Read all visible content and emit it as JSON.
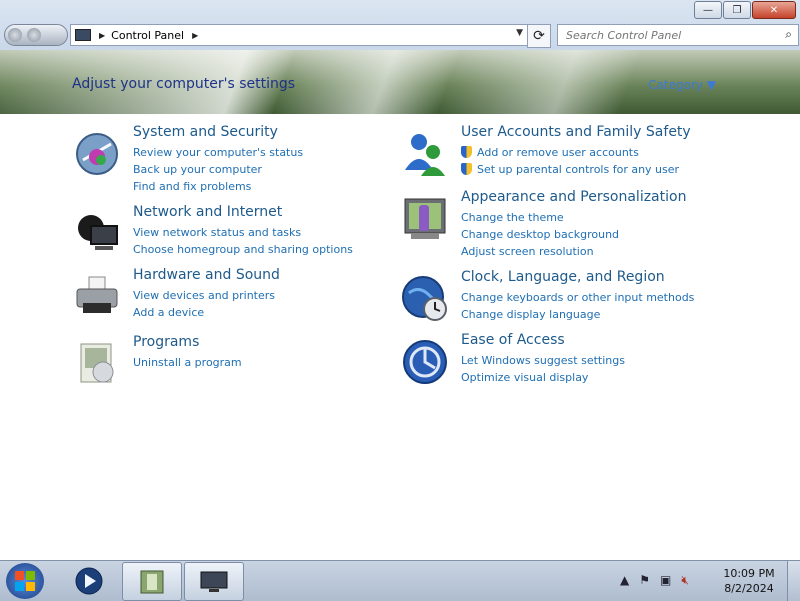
{
  "window": {
    "controls": {
      "minimize": "—",
      "maximize": "❐",
      "close": "✕"
    }
  },
  "address_bar": {
    "crumbs": [
      "Control Panel"
    ],
    "refresh_glyph": "⟳"
  },
  "search": {
    "placeholder": "Search Control Panel"
  },
  "banner": {
    "title": "Adjust your computer's settings",
    "view_by_label": "View by:",
    "view_by_value": "Category ▼"
  },
  "categories": {
    "left": [
      {
        "title": "System and Security",
        "icon": "system-security-icon",
        "links": [
          "Review your computer's status",
          "Back up your computer",
          "Find and fix problems"
        ]
      },
      {
        "title": "Network and Internet",
        "icon": "network-icon",
        "links": [
          "View network status and tasks",
          "Choose homegroup and sharing options"
        ]
      },
      {
        "title": "Hardware and Sound",
        "icon": "printer-icon",
        "links": [
          "View devices and printers",
          "Add a device"
        ]
      },
      {
        "title": "Programs",
        "icon": "programs-icon",
        "links": [
          "Uninstall a program"
        ]
      }
    ],
    "right": [
      {
        "title": "User Accounts and Family Safety",
        "icon": "users-icon",
        "links": [
          "Add or remove user accounts",
          "Set up parental controls for any user"
        ]
      },
      {
        "title": "Appearance and Personalization",
        "icon": "appearance-icon",
        "links": [
          "Change the theme",
          "Change desktop background",
          "Adjust screen resolution"
        ]
      },
      {
        "title": "Clock, Language, and Region",
        "icon": "globe-clock-icon",
        "links": [
          "Change keyboards or other input methods",
          "Change display language"
        ]
      },
      {
        "title": "Ease of Access",
        "icon": "ease-of-access-icon",
        "links": [
          "Let Windows suggest settings",
          "Optimize visual display"
        ]
      }
    ]
  },
  "taskbar": {
    "clock_time": "10:09 PM",
    "clock_date": "8/2/2024",
    "tray_icons": [
      "show-hidden-icons",
      "action-center-flag-icon",
      "network-icon",
      "volume-muted-icon"
    ]
  },
  "colors": {
    "link": "#1f6fb3",
    "heading": "#1e5a8b",
    "banner_text": "#1e3287"
  }
}
